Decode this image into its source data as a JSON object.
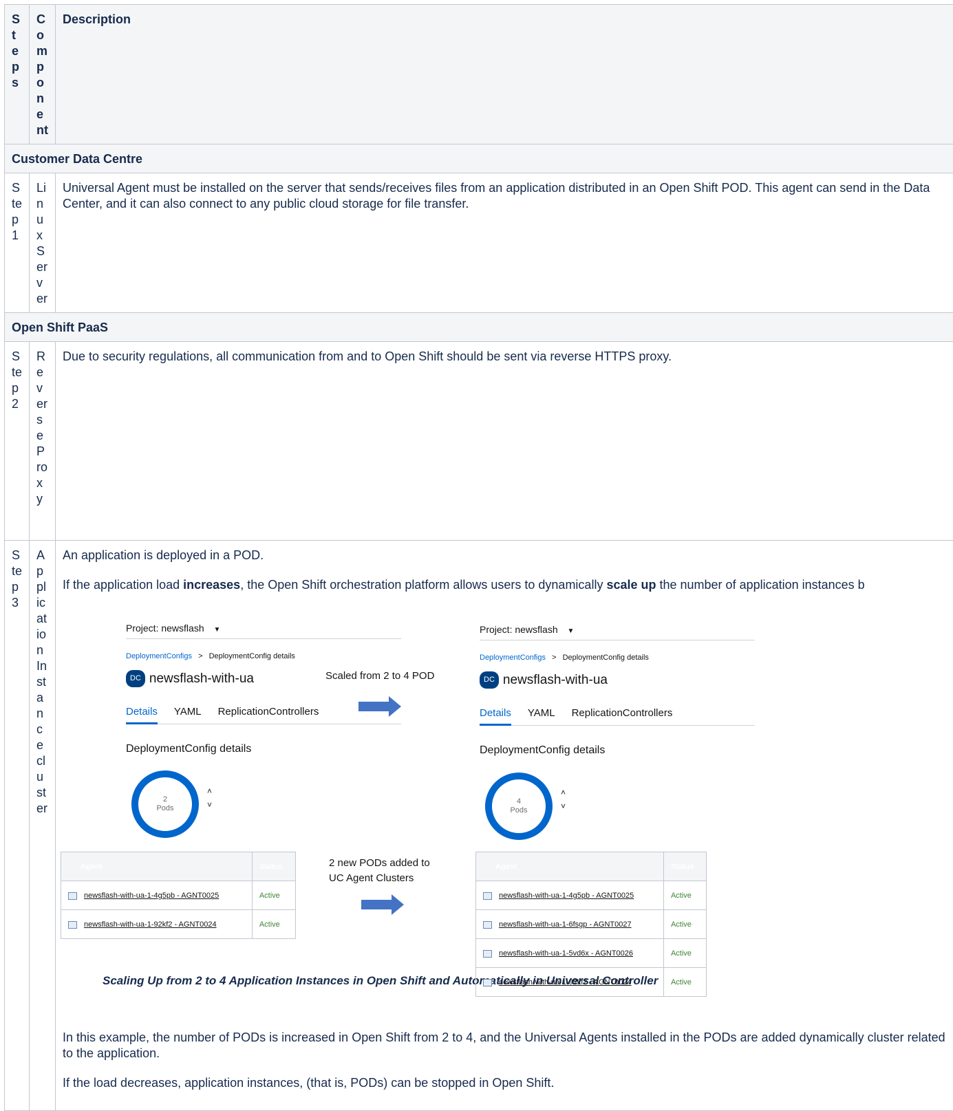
{
  "headers": {
    "steps": "Steps",
    "component": "Component",
    "description": "Description"
  },
  "sections": {
    "customer": "Customer Data Centre",
    "openshift": "Open Shift PaaS"
  },
  "rows": {
    "step1": {
      "step": "Step 1",
      "component": "Linux Server",
      "description": "Universal Agent must be installed on the server that sends/receives files from an application distributed in an Open Shift POD. This agent can send in the Data Center, and it can also connect to any public cloud storage for file transfer."
    },
    "step2": {
      "step": "Step 2",
      "component": "Reverse Proxy",
      "description": "Due to security regulations, all communication from and to Open Shift should be sent via reverse HTTPS proxy."
    },
    "step3": {
      "step": "Step 3",
      "component": "Application Instance cluster",
      "p1": "An application is deployed in a POD.",
      "p2_before": "If the application load ",
      "p2_bold1": "increases",
      "p2_mid": ", the Open Shift orchestration platform allows users to dynamically ",
      "p2_bold2": "scale up",
      "p2_after": " the number of application instances b",
      "caption": "Scaling Up from 2 to 4 Application Instances in Open Shift and Automatically in Universal Controller",
      "p3": "In this example, the number of PODs is increased in Open Shift from 2 to 4, and the Universal Agents installed in the PODs are added dynamically cluster related to the application.",
      "p4": "If the load decreases, application instances, (that is, PODs) can be stopped in Open Shift."
    }
  },
  "figure": {
    "project_label": "Project: newsflash",
    "breadcrumb_link": "DeploymentConfigs",
    "breadcrumb_sep": ">",
    "breadcrumb_current": "DeploymentConfig details",
    "dc_badge": "DC",
    "dc_name": "newsflash-with-ua",
    "tabs": [
      "Details",
      "YAML",
      "ReplicationControllers"
    ],
    "details_heading": "DeploymentConfig details",
    "pods_unit": "Pods",
    "before_pods": "2",
    "after_pods": "4",
    "note_scaled": "Scaled from 2 to 4 POD",
    "note_added_1": "2 new PODs added to",
    "note_added_2": "UC Agent Clusters",
    "agent_header": "Agent",
    "status_header": "Status",
    "before_agents": [
      {
        "name": "newsflash-with-ua-1-4g5pb - AGNT0025",
        "status": "Active"
      },
      {
        "name": "newsflash-with-ua-1-92kf2 - AGNT0024",
        "status": "Active"
      }
    ],
    "after_agents": [
      {
        "name": "newsflash-with-ua-1-4g5pb - AGNT0025",
        "status": "Active"
      },
      {
        "name": "newsflash-with-ua-1-6fsgp - AGNT0027",
        "status": "Active"
      },
      {
        "name": "newsflash-with-ua-1-5vd6x - AGNT0026",
        "status": "Active"
      },
      {
        "name": "newsflash-with-ua-1-92kf2 - AGNT0024",
        "status": "Active"
      }
    ],
    "accent": "#0066cc",
    "arrow_color": "#4472c4"
  }
}
